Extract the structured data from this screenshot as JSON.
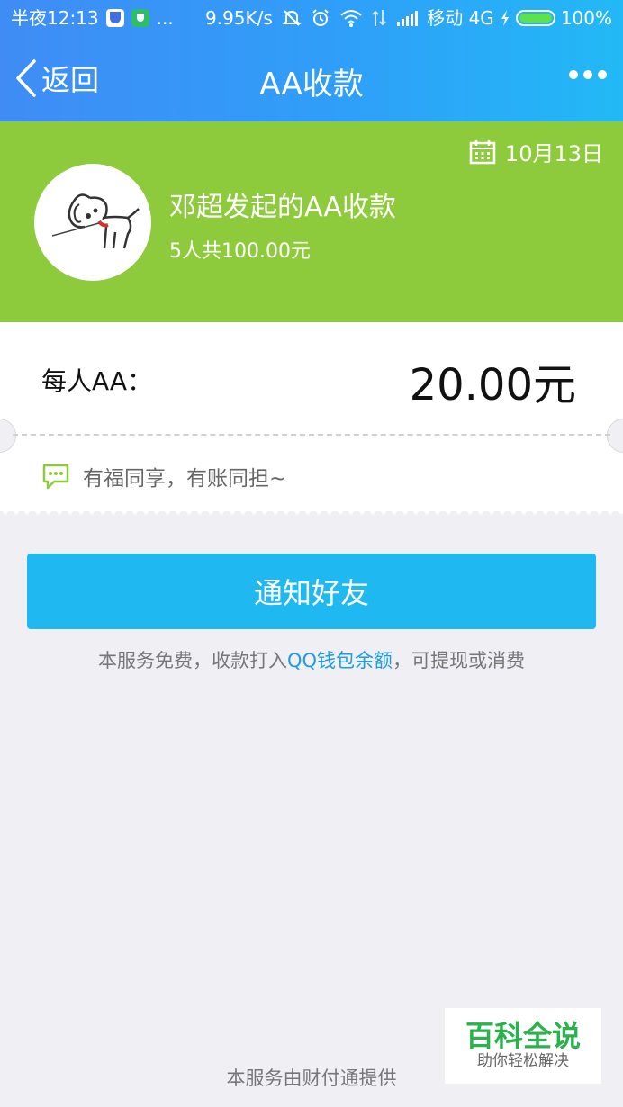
{
  "status_bar": {
    "time": "半夜12:13",
    "more": "...",
    "network_speed": "9.95K/s",
    "carrier": "移动 4G",
    "battery": "100%",
    "icons": [
      "shield-icon",
      "green-shield-icon",
      "mute-icon",
      "alarm-icon",
      "wifi-icon",
      "data-arrows-icon",
      "signal-icon",
      "charging-icon",
      "battery-icon"
    ]
  },
  "nav": {
    "back_label": "返回",
    "title": "AA收款",
    "more_icon": "more-dots-icon"
  },
  "header": {
    "background_color": "#8ecb3c",
    "date": "10月13日",
    "title": "邓超发起的AA收款",
    "summary": "5人共100.00元",
    "avatar_icon": "dog-avatar"
  },
  "per_person": {
    "label": "每人AA：",
    "amount": "20.00元"
  },
  "message": {
    "icon": "chat-bubble-icon",
    "text": "有福同享，有账同担~"
  },
  "actions": {
    "notify_label": "通知好友",
    "accent_color": "#20b8f0"
  },
  "service_note": {
    "before": "本服务免费，收款打入",
    "link": "QQ钱包余额",
    "after": "，可提现或消费"
  },
  "footer": {
    "provider": "本服务由财付通提供"
  },
  "watermark": {
    "title": "百科全说",
    "subtitle": "助你轻松解决"
  }
}
